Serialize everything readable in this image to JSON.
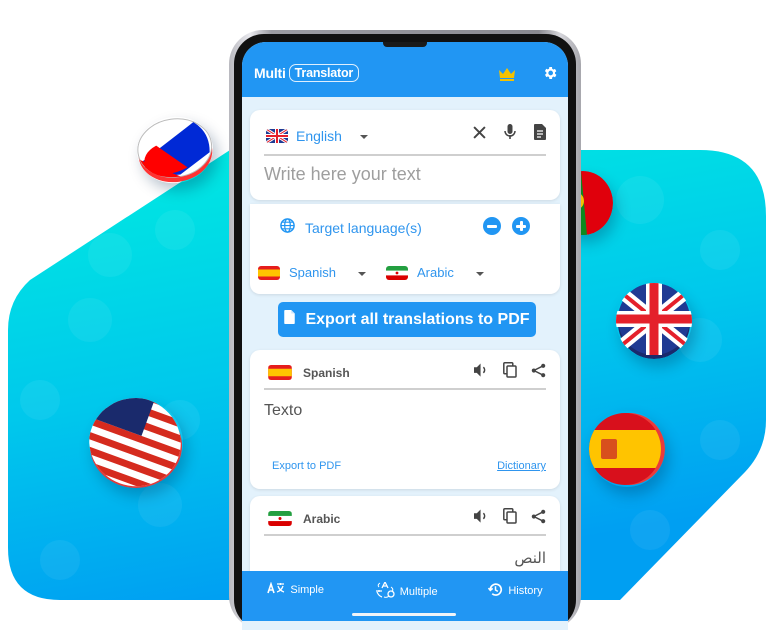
{
  "app": {
    "brand_first": "Multi",
    "brand_second": "Translator",
    "premium_icon": "crown-icon",
    "settings_icon": "gear-icon"
  },
  "source": {
    "language": "English",
    "flag": "uk",
    "input_placeholder": "Write here your text",
    "input_value": "",
    "tools": [
      "close-icon",
      "microphone-icon",
      "document-icon"
    ]
  },
  "target": {
    "label": "Target language(s)",
    "remove_label": "−",
    "add_label": "+",
    "selected": [
      {
        "language": "Spanish",
        "flag": "spain"
      },
      {
        "language": "Arabic",
        "flag": "iran"
      }
    ]
  },
  "export_all_label": "Export all translations to PDF",
  "results": [
    {
      "language": "Spanish",
      "flag": "spain",
      "text": "Texto",
      "export_label": "Export to PDF",
      "dictionary_label": "Dictionary"
    },
    {
      "language": "Arabic",
      "flag": "iran",
      "text": "النص"
    }
  ],
  "nav": {
    "items": [
      {
        "label": "Simple",
        "icon": "translate-icon"
      },
      {
        "label": "Multiple",
        "icon": "multi-translate-icon"
      },
      {
        "label": "History",
        "icon": "history-icon"
      }
    ],
    "active": "Multiple"
  },
  "decor": {
    "coins": [
      "russia",
      "portugal",
      "united-kingdom",
      "usa",
      "spain"
    ],
    "colors": {
      "primary": "#2196f3",
      "accent_text": "#2f95ee",
      "bg_top": "#00e8dc",
      "bg_bottom": "#00a5f0",
      "crown": "#f5c200"
    }
  }
}
